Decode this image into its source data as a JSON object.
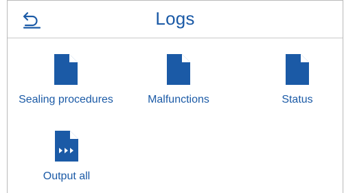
{
  "header": {
    "title": "Logs",
    "back_icon": "back-arrow-icon"
  },
  "tiles": [
    {
      "label": "Sealing procedures",
      "icon": "document-icon"
    },
    {
      "label": "Malfunctions",
      "icon": "document-icon"
    },
    {
      "label": "Status",
      "icon": "document-icon"
    },
    {
      "label": "Output all",
      "icon": "document-forward-icon"
    }
  ],
  "colors": {
    "accent": "#1b5aa6",
    "divider": "#c8c8c8",
    "background": "#ffffff"
  }
}
